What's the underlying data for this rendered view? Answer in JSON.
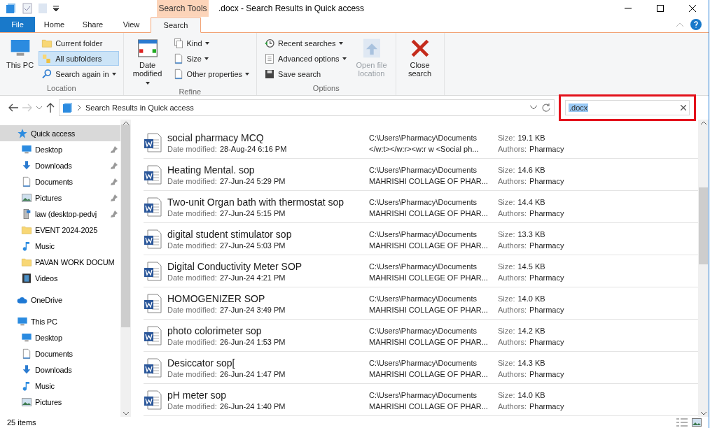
{
  "window": {
    "title": ".docx - Search Results in Quick access"
  },
  "ribbon": {
    "context_label": "Search Tools",
    "tabs": [
      {
        "label": "File",
        "selected": false,
        "kind": "file"
      },
      {
        "label": "Home",
        "selected": false,
        "kind": "tab"
      },
      {
        "label": "Share",
        "selected": false,
        "kind": "tab"
      },
      {
        "label": "View",
        "selected": false,
        "kind": "tab"
      },
      {
        "label": "Search",
        "selected": true,
        "kind": "tab"
      }
    ],
    "groups": [
      {
        "label": "Location",
        "large": [
          {
            "label": "This PC",
            "dropdown": false,
            "disabled": false
          }
        ],
        "small": [
          {
            "label": "Current folder",
            "dropdown": false,
            "selected": false
          },
          {
            "label": "All subfolders",
            "dropdown": false,
            "selected": true
          },
          {
            "label": "Search again in",
            "dropdown": true,
            "selected": false
          }
        ]
      },
      {
        "label": "Refine",
        "large": [
          {
            "label": "Date modified",
            "dropdown": true,
            "disabled": false
          }
        ],
        "small": [
          {
            "label": "Kind",
            "dropdown": true,
            "selected": false
          },
          {
            "label": "Size",
            "dropdown": true,
            "selected": false
          },
          {
            "label": "Other properties",
            "dropdown": true,
            "selected": false
          }
        ]
      },
      {
        "label": "Options",
        "small": [
          {
            "label": "Recent searches",
            "dropdown": true,
            "selected": false
          },
          {
            "label": "Advanced options",
            "dropdown": true,
            "selected": false
          },
          {
            "label": "Save search",
            "dropdown": false,
            "selected": false
          }
        ],
        "large": [
          {
            "label": "Open file location",
            "dropdown": false,
            "disabled": true
          }
        ]
      },
      {
        "large": [
          {
            "label": "Close search",
            "dropdown": false,
            "disabled": false
          }
        ]
      }
    ]
  },
  "address": {
    "path": "Search Results in Quick access",
    "search": ".docx"
  },
  "nav": [
    {
      "label": "Quick access",
      "selected": true,
      "children": [
        {
          "label": "Desktop",
          "pinned": true
        },
        {
          "label": "Downloads",
          "pinned": true
        },
        {
          "label": "Documents",
          "pinned": true
        },
        {
          "label": "Pictures",
          "pinned": true
        },
        {
          "label": "law (desktop-pedvj",
          "pinned": true
        },
        {
          "label": "EVENT 2024-2025",
          "pinned": false
        },
        {
          "label": "Music",
          "pinned": false
        },
        {
          "label": "PAVAN WORK DOCUM",
          "pinned": false
        },
        {
          "label": "Videos",
          "pinned": false
        }
      ]
    },
    {
      "label": "OneDrive",
      "selected": false
    },
    {
      "label": "This PC",
      "selected": false,
      "children": [
        {
          "label": "Desktop",
          "pinned": false
        },
        {
          "label": "Documents",
          "pinned": false
        },
        {
          "label": "Downloads",
          "pinned": false
        },
        {
          "label": "Music",
          "pinned": false
        },
        {
          "label": "Pictures",
          "pinned": false
        }
      ]
    }
  ],
  "results": [
    {
      "name": "social pharmacy MCQ",
      "date_label": "Date modified:",
      "date": "28-Aug-24 6:16 PM",
      "path": "C:\\Users\\Pharmacy\\Documents",
      "snippet": "</w:t></w:r><w:r w <Social ph...",
      "size_label": "Size:",
      "size": "19.1 KB",
      "authors_label": "Authors:",
      "authors": "Pharmacy"
    },
    {
      "name": "Heating Mental. sop",
      "date_label": "Date modified:",
      "date": "27-Jun-24 5:29 PM",
      "path": "C:\\Users\\Pharmacy\\Documents",
      "snippet": "MAHRISHI COLLAGE OF PHAR...",
      "size_label": "Size:",
      "size": "14.6 KB",
      "authors_label": "Authors:",
      "authors": "Pharmacy"
    },
    {
      "name": "Two-unit Organ bath with thermostat sop",
      "date_label": "Date modified:",
      "date": "27-Jun-24 5:15 PM",
      "path": "C:\\Users\\Pharmacy\\Documents",
      "snippet": "MAHRISHI COLLAGE OF PHAR...",
      "size_label": "Size:",
      "size": "14.4 KB",
      "authors_label": "Authors:",
      "authors": "Pharmacy"
    },
    {
      "name": "digital student stimulator sop",
      "date_label": "Date modified:",
      "date": "27-Jun-24 5:03 PM",
      "path": "C:\\Users\\Pharmacy\\Documents",
      "snippet": "MAHRISHI COLLAGE OF PHAR...",
      "size_label": "Size:",
      "size": "13.3 KB",
      "authors_label": "Authors:",
      "authors": "Pharmacy"
    },
    {
      "name": "Digital Conductivity Meter SOP",
      "date_label": "Date modified:",
      "date": "27-Jun-24 4:21 PM",
      "path": "C:\\Users\\Pharmacy\\Documents",
      "snippet": "MAHRISHI COLLEGE OF PHAR...",
      "size_label": "Size:",
      "size": "14.5 KB",
      "authors_label": "Authors:",
      "authors": "Pharmacy"
    },
    {
      "name": "HOMOGENIZER SOP",
      "date_label": "Date modified:",
      "date": "27-Jun-24 3:49 PM",
      "path": "C:\\Users\\Pharmacy\\Documents",
      "snippet": "MAHRISHI COLLAGE OF PHAR...",
      "size_label": "Size:",
      "size": "14.0 KB",
      "authors_label": "Authors:",
      "authors": "Pharmacy"
    },
    {
      "name": "photo colorimeter sop",
      "date_label": "Date modified:",
      "date": "26-Jun-24 1:53 PM",
      "path": "C:\\Users\\Pharmacy\\Documents",
      "snippet": "MAHRISHI COLLAGE OF PHAR...",
      "size_label": "Size:",
      "size": "14.2 KB",
      "authors_label": "Authors:",
      "authors": "Pharmacy"
    },
    {
      "name": "Desiccator sop[",
      "date_label": "Date modified:",
      "date": "26-Jun-24 1:47 PM",
      "path": "C:\\Users\\Pharmacy\\Documents",
      "snippet": "MAHRISHI COLLAGE OF PHAR...",
      "size_label": "Size:",
      "size": "14.3 KB",
      "authors_label": "Authors:",
      "authors": "Pharmacy"
    },
    {
      "name": "pH meter sop",
      "date_label": "Date modified:",
      "date": "26-Jun-24 1:40 PM",
      "path": "C:\\Users\\Pharmacy\\Documents",
      "snippet": "MAHRISHI COLLAGE OF PHAR...",
      "size_label": "Size:",
      "size": "14.0 KB",
      "authors_label": "Authors:",
      "authors": "Pharmacy"
    }
  ],
  "status_bar": {
    "count": "25 items"
  }
}
